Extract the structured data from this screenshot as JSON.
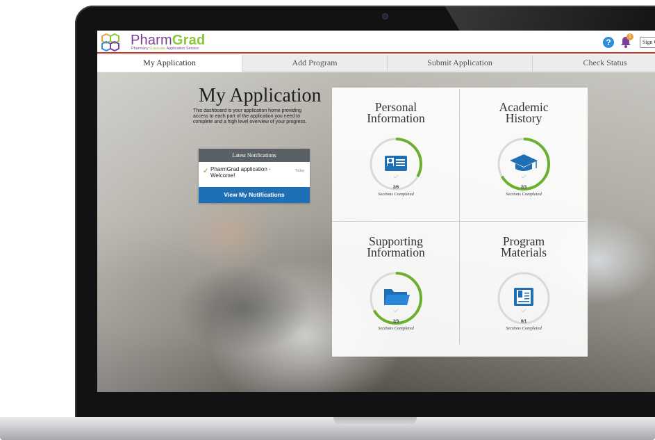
{
  "header": {
    "logo_brand_main": "Pharm",
    "logo_brand_accent": "Grad",
    "logo_sub_pre": "Pharmacy",
    "logo_sub_accent": "Graduate",
    "logo_sub_post": "Application Service",
    "help_icon": "question-circle-icon",
    "notification_icon": "bell-icon",
    "notification_count": "1",
    "sign_out_label": "Sign Out"
  },
  "tabs": [
    {
      "label": "My Application",
      "active": true
    },
    {
      "label": "Add Program",
      "active": false
    },
    {
      "label": "Submit Application",
      "active": false
    },
    {
      "label": "Check Status",
      "active": false
    }
  ],
  "intro": {
    "title": "My Application",
    "description": "This dashboard is your application home providing access to each part of the application you need to complete and a high level overview of your progress."
  },
  "notifications": {
    "header": "Latest Notifications",
    "items": [
      {
        "text": "PharmGrad application - Welcome!",
        "time": "Today",
        "icon": "check-icon"
      }
    ],
    "button_label": "View My Notifications"
  },
  "cards": [
    {
      "title_line1": "Personal",
      "title_line2": "Information",
      "count": "2/6",
      "label": "Sections Completed",
      "icon": "id-card-icon",
      "progress": 0.333
    },
    {
      "title_line1": "Academic",
      "title_line2": "History",
      "count": "2/3",
      "label": "Sections Completed",
      "icon": "graduation-cap-icon",
      "progress": 0.667
    },
    {
      "title_line1": "Supporting",
      "title_line2": "Information",
      "count": "2/3",
      "label": "Sections Completed",
      "icon": "folder-icon",
      "progress": 0.667
    },
    {
      "title_line1": "Program",
      "title_line2": "Materials",
      "count": "0/1",
      "label": "Sections Completed",
      "icon": "book-icon",
      "progress": 0.0
    }
  ],
  "colors": {
    "brand_purple": "#7b3f98",
    "brand_green": "#8cc63f",
    "primary_blue": "#1f6fb5",
    "progress_green": "#6aaf2e",
    "header_rule": "#c0392b"
  }
}
